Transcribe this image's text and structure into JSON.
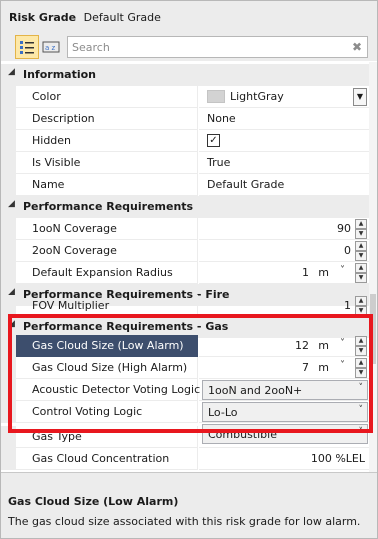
{
  "header": {
    "title_bold": "Risk Grade",
    "title_value": "Default Grade",
    "search_placeholder": "Search",
    "clear_glyph": "✖"
  },
  "categories": {
    "information": "Information",
    "perf_req": "Performance Requirements",
    "perf_fire": "Performance Requirements - Fire",
    "perf_gas": "Performance Requirements - Gas"
  },
  "properties": {
    "color": {
      "name": "Color",
      "value": "LightGray",
      "swatch": "#d3d3d3"
    },
    "description": {
      "name": "Description",
      "value": "None"
    },
    "hidden": {
      "name": "Hidden",
      "checked": true,
      "glyph": "✓"
    },
    "is_visible": {
      "name": "Is Visible",
      "value": "True"
    },
    "grade_name": {
      "name": "Name",
      "value": "Default Grade"
    },
    "cov_1oon": {
      "name": "1ooN Coverage",
      "value": "90"
    },
    "cov_2oon": {
      "name": "2ooN Coverage",
      "value": "0"
    },
    "expansion": {
      "name": "Default Expansion Radius",
      "value": "1",
      "unit": "m"
    },
    "fov": {
      "name": "FOV Multiplier",
      "value": "1"
    },
    "gcs_low": {
      "name": "Gas Cloud Size (Low Alarm)",
      "value": "12",
      "unit": "m"
    },
    "gcs_high": {
      "name": "Gas Cloud Size (High Alarm)",
      "value": "7",
      "unit": "m"
    },
    "acoustic": {
      "name": "Acoustic Detector Voting Logic",
      "value": "1ooN and 2ooN+"
    },
    "control": {
      "name": "Control Voting Logic",
      "value": "Lo-Lo"
    },
    "gas_type": {
      "name": "Gas Type",
      "value": "Combustible"
    },
    "gas_conc": {
      "name": "Gas Cloud Concentration",
      "value": "100 %LEL"
    }
  },
  "description_panel": {
    "title": "Gas Cloud Size (Low Alarm)",
    "text": "The gas cloud size associated with this risk grade for low alarm."
  },
  "colors": {
    "selection": "#3d4e6d",
    "highlight_border": "#e8171e",
    "active_view": "#fde8a8"
  }
}
